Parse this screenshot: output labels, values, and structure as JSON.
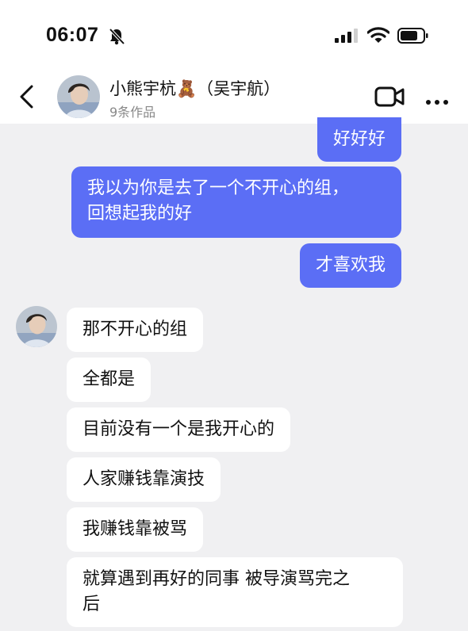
{
  "status_bar": {
    "time": "06:07",
    "icons": [
      "mute-bell-icon",
      "signal-icon",
      "wifi-icon",
      "battery-icon"
    ]
  },
  "header": {
    "back_icon": "chevron-left-icon",
    "name": "小熊宇杭🧸（吴宇航）",
    "subtitle": "9条作品",
    "video_icon": "video-camera-icon",
    "more_icon": "more-dots-icon"
  },
  "colors": {
    "outgoing_bubble": "#5b6ef5",
    "incoming_bubble": "#ffffff",
    "background": "#f0f0f2"
  },
  "messages": [
    {
      "side": "out",
      "text": "好好好"
    },
    {
      "side": "out",
      "text": "我以为你是去了一个不开心的组，\n回想起我的好"
    },
    {
      "side": "out",
      "text": "才喜欢我"
    },
    {
      "side": "in",
      "text": "那不开心的组"
    },
    {
      "side": "in",
      "text": "全都是"
    },
    {
      "side": "in",
      "text": "目前没有一个是我开心的"
    },
    {
      "side": "in",
      "text": "人家赚钱靠演技"
    },
    {
      "side": "in",
      "text": "我赚钱靠被骂"
    },
    {
      "side": "in",
      "text": "就算遇到再好的同事 被导演骂完之\n后"
    }
  ]
}
